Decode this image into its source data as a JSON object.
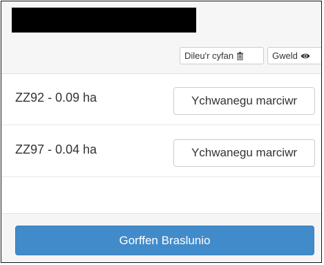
{
  "toolbar": {
    "clear_all_label": "Dileu'r cyfan",
    "clear_all_icon": "trash-icon",
    "view_label": "Gweld",
    "view_icon": "eye-icon"
  },
  "parcels": [
    {
      "label": "ZZ92 - 0.09 ha",
      "button_label": "Ychwanegu marciwr"
    },
    {
      "label": "ZZ97 - 0.04 ha",
      "button_label": "Ychwanegu marciwr"
    }
  ],
  "footer": {
    "finish_label": "Gorffen Braslunio"
  },
  "colors": {
    "primary": "#428bca",
    "redaction": "#000000"
  }
}
